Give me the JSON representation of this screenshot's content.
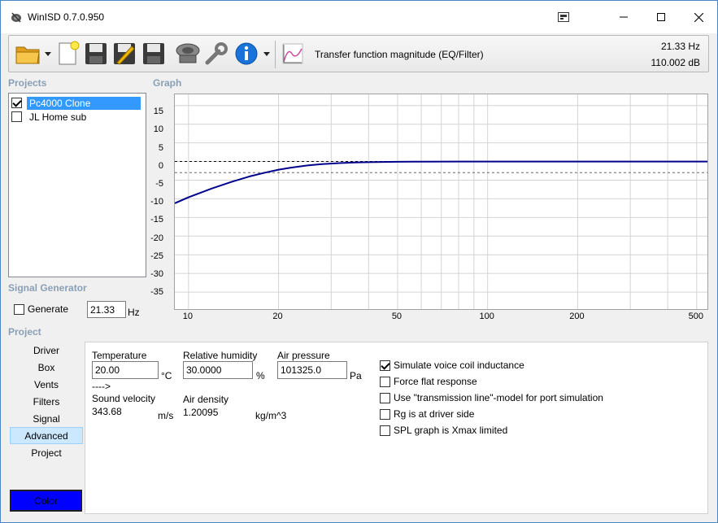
{
  "window": {
    "title": "WinISD 0.7.0.950"
  },
  "toolbar": {
    "graph_type_label": "Transfer function magnitude (EQ/Filter)",
    "cursor_freq": "21.33 Hz",
    "cursor_value": "110.002 dB"
  },
  "projects": {
    "label": "Projects",
    "items": [
      {
        "name": "Pc4000 Clone",
        "checked": true,
        "selected": true
      },
      {
        "name": "JL Home sub",
        "checked": false,
        "selected": false
      }
    ]
  },
  "graph": {
    "label": "Graph",
    "y_ticks": [
      "15",
      "10",
      "5",
      "0",
      "-5",
      "-10",
      "-15",
      "-20",
      "-25",
      "-30",
      "-35"
    ],
    "x_ticks": [
      "10",
      "20",
      "50",
      "100",
      "200",
      "500"
    ]
  },
  "chart_data": {
    "type": "line",
    "xscale": "log",
    "xlim": [
      9,
      550
    ],
    "ylim": [
      -40,
      18
    ],
    "grid": true,
    "reference_lines": [
      0,
      -3
    ],
    "series": [
      {
        "color": "#00008b",
        "x": [
          9,
          10,
          12,
          14,
          16,
          18,
          20,
          22,
          25,
          28,
          32,
          36,
          40,
          50,
          60,
          80,
          100,
          200,
          550
        ],
        "y": [
          -11.2,
          -9.6,
          -7.2,
          -5.4,
          -4.0,
          -3.0,
          -2.2,
          -1.65,
          -1.05,
          -0.7,
          -0.42,
          -0.28,
          -0.18,
          -0.08,
          -0.04,
          -0.02,
          -0.01,
          0,
          0
        ]
      }
    ]
  },
  "signal_generator": {
    "label": "Signal Generator",
    "generate_label": "Generate",
    "generate_checked": false,
    "frequency": "21.33",
    "unit": "Hz"
  },
  "project": {
    "label": "Project",
    "nav": [
      "Driver",
      "Box",
      "Vents",
      "Filters",
      "Signal",
      "Advanced",
      "Project"
    ],
    "active_nav": "Advanced",
    "color_label": "Color"
  },
  "advanced": {
    "temperature_label": "Temperature",
    "temperature": "20.00",
    "temperature_unit": "°C",
    "humidity_label": "Relative humidity",
    "humidity": "30.0000",
    "humidity_unit": "%",
    "pressure_label": "Air pressure",
    "pressure": "101325.0",
    "pressure_unit": "Pa",
    "arrow_text": "---->",
    "sound_velocity_label": "Sound velocity",
    "sound_velocity": "343.68",
    "sound_velocity_unit": "m/s",
    "air_density_label": "Air density",
    "air_density": "1.20095",
    "air_density_unit": "kg/m^3",
    "options": [
      {
        "label": "Simulate voice coil inductance",
        "checked": true
      },
      {
        "label": "Force flat response",
        "checked": false
      },
      {
        "label": "Use \"transmission line\"-model for port simulation",
        "checked": false
      },
      {
        "label": "Rg is at driver side",
        "checked": false
      },
      {
        "label": "SPL graph is Xmax limited",
        "checked": false
      }
    ]
  },
  "colors": {
    "accent": "#3399ff",
    "curve": "#00008b",
    "project_color": "#0000ff"
  }
}
